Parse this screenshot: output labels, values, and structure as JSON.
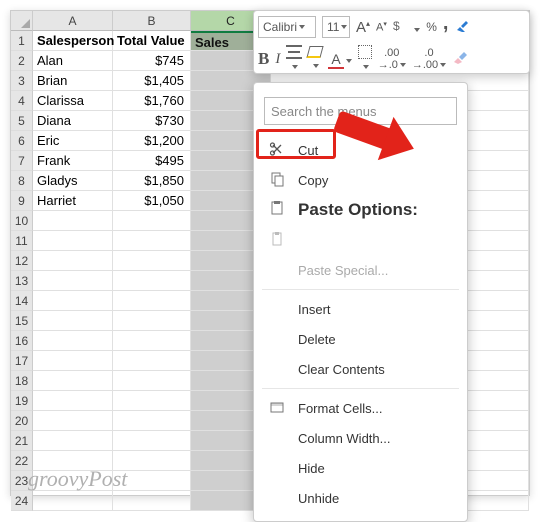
{
  "toolbar": {
    "font": "Calibri",
    "size": "11",
    "bold": "B",
    "italic": "I",
    "fontcolor": "A",
    "percent": "%",
    "comma": ","
  },
  "columns": [
    "A",
    "B",
    "C"
  ],
  "headers": {
    "A": "Salesperson",
    "B": "Total Value",
    "C": "Sales"
  },
  "rows": [
    {
      "n": "1"
    },
    {
      "n": "2",
      "a": "Alan",
      "b": "$745"
    },
    {
      "n": "3",
      "a": "Brian",
      "b": "$1,405"
    },
    {
      "n": "4",
      "a": "Clarissa",
      "b": "$1,760"
    },
    {
      "n": "5",
      "a": "Diana",
      "b": "$730"
    },
    {
      "n": "6",
      "a": "Eric",
      "b": "$1,200"
    },
    {
      "n": "7",
      "a": "Frank",
      "b": "$495"
    },
    {
      "n": "8",
      "a": "Gladys",
      "b": "$1,850"
    },
    {
      "n": "9",
      "a": "Harriet",
      "b": "$1,050"
    },
    {
      "n": "10"
    },
    {
      "n": "11"
    },
    {
      "n": "12"
    },
    {
      "n": "13"
    },
    {
      "n": "14"
    },
    {
      "n": "15"
    },
    {
      "n": "16"
    },
    {
      "n": "17"
    },
    {
      "n": "18"
    },
    {
      "n": "19"
    },
    {
      "n": "20"
    },
    {
      "n": "21"
    },
    {
      "n": "22"
    },
    {
      "n": "23"
    },
    {
      "n": "24"
    }
  ],
  "ctx": {
    "search_placeholder": "Search the menus",
    "cut": "Cut",
    "copy": "Copy",
    "paste_options": "Paste Options:",
    "paste_special": "Paste Special...",
    "insert": "Insert",
    "delete": "Delete",
    "clear": "Clear Contents",
    "format_cells": "Format Cells...",
    "column_width": "Column Width...",
    "hide": "Hide",
    "unhide": "Unhide"
  },
  "watermark": "groovyPost"
}
